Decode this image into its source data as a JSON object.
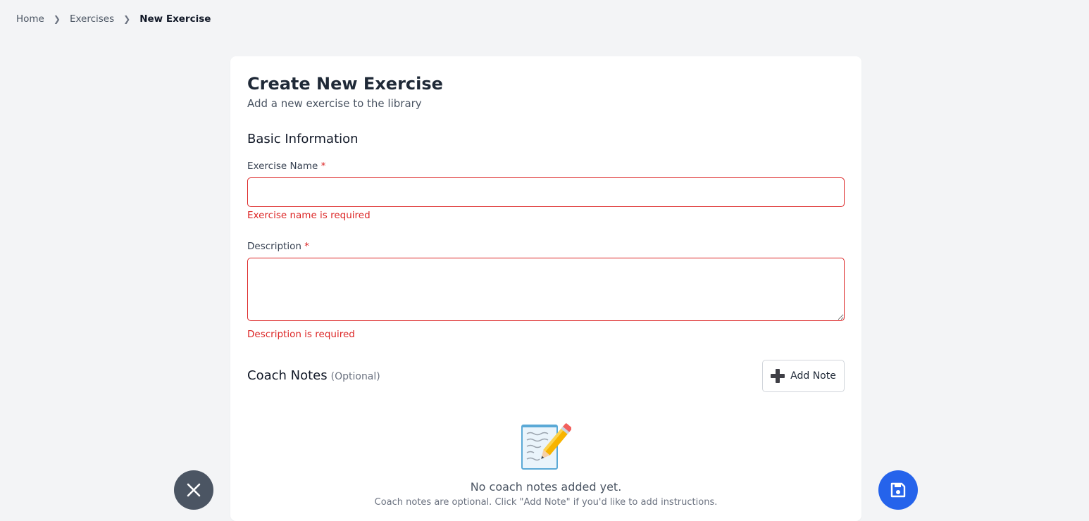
{
  "breadcrumb": {
    "items": [
      "Home",
      "Exercises"
    ],
    "current": "New Exercise"
  },
  "header": {
    "title": "Create New Exercise",
    "subtitle": "Add a new exercise to the library"
  },
  "basic_info": {
    "section_title": "Basic Information",
    "name_field": {
      "label": "Exercise Name",
      "required_mark": "*",
      "value": "",
      "error": "Exercise name is required"
    },
    "description_field": {
      "label": "Description",
      "required_mark": "*",
      "value": "",
      "error": "Description is required"
    }
  },
  "coach_notes": {
    "title": "Coach Notes",
    "optional_label": "(Optional)",
    "add_button_label": "Add Note",
    "add_button_icon": "plus-icon",
    "empty_icon": "memo-pencil-icon",
    "empty_title": "No coach notes added yet.",
    "empty_subtitle": "Coach notes are optional. Click \"Add Note\" if you'd like to add instructions."
  },
  "actions": {
    "cancel_icon": "close-icon",
    "save_icon": "save-icon"
  },
  "colors": {
    "error": "#dc2626",
    "primary": "#2563eb",
    "secondary_fab": "#4b5563",
    "background": "#f3f4f6"
  }
}
